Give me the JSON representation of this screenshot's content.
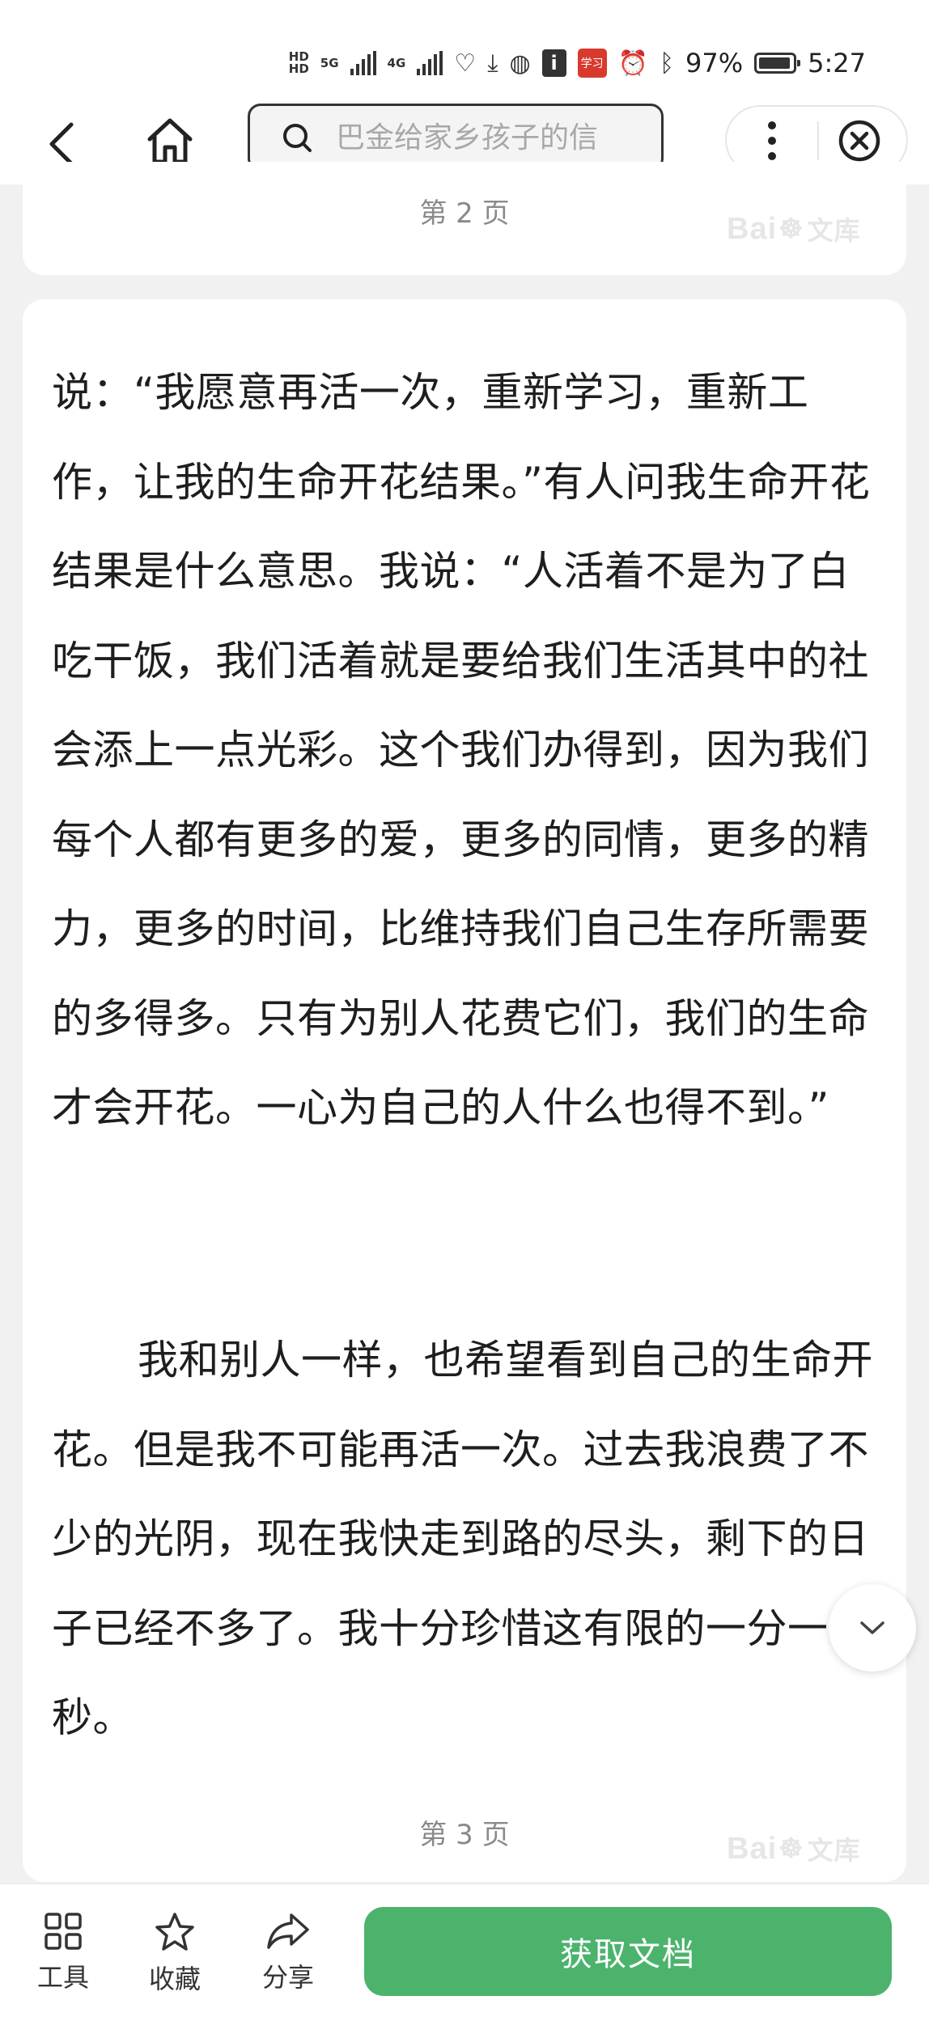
{
  "status_bar": {
    "hd1": "HD",
    "hd2": "HD",
    "net1": "5G",
    "net2": "4G",
    "battery": "97%",
    "time": "5:27",
    "app_badge": "i",
    "red_app": "学习"
  },
  "nav": {
    "search_placeholder": "巴金给家乡孩子的信"
  },
  "doc": {
    "page2_label": "第 2 页",
    "page3_label": "第 3 页",
    "watermark_a": "Bai",
    "watermark_b": "文库",
    "paragraph1": "说：“我愿意再活一次，重新学习，重新工作，让我的生命开花结果。”有人问我生命开花结果是什么意思。我说：“人活着不是为了白吃干饭，我们活着就是要给我们生活其中的社会添上一点光彩。这个我们办得到，因为我们每个人都有更多的爱，更多的同情，更多的精力，更多的时间，比维持我们自己生存所需要的多得多。只有为别人花费它们，我们的生命才会开花。一心为自己的人什么也得不到。”",
    "paragraph2": "我和别人一样，也希望看到自己的生命开花。但是我不可能再活一次。过去我浪费了不少的光阴，现在我快走到路的尽头，剩下的日子已经不多了。我十分珍惜这有限的一分一秒。"
  },
  "toolbar": {
    "tools_label": "工具",
    "favorite_label": "收藏",
    "share_label": "分享",
    "get_doc_label": "获取文档"
  },
  "colors": {
    "accent_green": "#4cb36d",
    "background": "#f1f1f1"
  }
}
